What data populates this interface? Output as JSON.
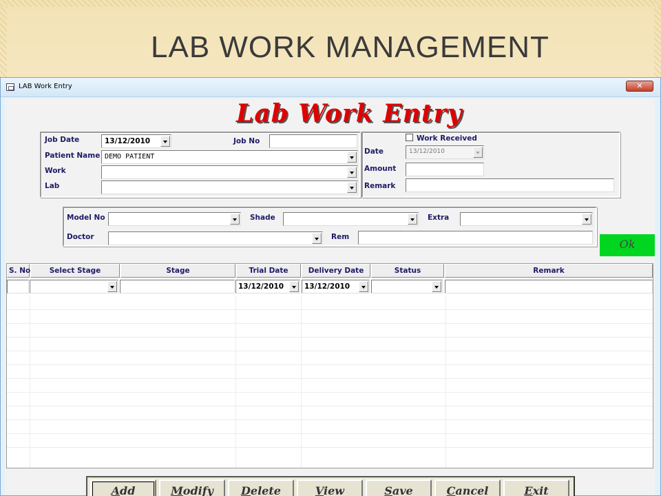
{
  "slide": {
    "title": "LAB WORK MANAGEMENT"
  },
  "window": {
    "title": "LAB Work Entry",
    "close_glyph": "✕"
  },
  "form": {
    "heading": "Lab Work Entry",
    "job_date": {
      "label": "Job Date",
      "value": "13/12/2010"
    },
    "job_no": {
      "label": "Job No",
      "value": ""
    },
    "patient_name": {
      "label": "Patient Name",
      "value": "DEMO PATIENT"
    },
    "work": {
      "label": "Work",
      "value": ""
    },
    "lab": {
      "label": "Lab",
      "value": ""
    },
    "work_received": {
      "label": "Work Received",
      "checked": false
    },
    "date": {
      "label": "Date",
      "value": "13/12/2010"
    },
    "amount": {
      "label": "Amount",
      "value": ""
    },
    "remark": {
      "label": "Remark",
      "value": ""
    },
    "model_no": {
      "label": "Model No",
      "value": ""
    },
    "shade": {
      "label": "Shade",
      "value": ""
    },
    "extra": {
      "label": "Extra",
      "value": ""
    },
    "doctor": {
      "label": "Doctor",
      "value": ""
    },
    "rem": {
      "label": "Rem",
      "value": ""
    },
    "ok_label": "Ok"
  },
  "grid": {
    "headers": [
      "S. No",
      "Select Stage",
      "Stage",
      "Trial Date",
      "Delivery Date",
      "Status",
      "Remark"
    ],
    "entry_row": {
      "sno": "",
      "select_stage": "",
      "stage": "",
      "trial_date": "13/12/2010",
      "delivery_date": "13/12/2010",
      "status": "",
      "remark": ""
    }
  },
  "buttons": {
    "add": {
      "u": "A",
      "rest": "dd"
    },
    "modify": {
      "u": "M",
      "rest": "odify"
    },
    "delete": {
      "u": "D",
      "rest": "elete"
    },
    "view": {
      "u": "V",
      "rest": "iew"
    },
    "save": {
      "u": "S",
      "rest": "ave"
    },
    "cancel": {
      "u": "C",
      "rest": "ancel"
    },
    "exit": {
      "u": "E",
      "rest": "xit"
    }
  },
  "colors": {
    "accent_red": "#e00000",
    "ok_green": "#00d51f",
    "label_navy": "#1d1a66"
  }
}
